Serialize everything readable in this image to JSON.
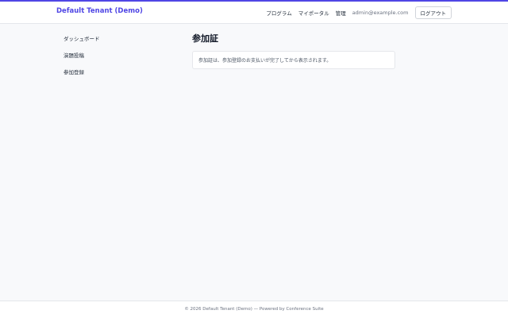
{
  "header": {
    "brand": "Default Tenant (Demo)",
    "nav": {
      "program": "プログラム",
      "my_portal": "マイポータル",
      "admin": "管理"
    },
    "user_email": "admin@example.com",
    "logout_label": "ログアウト",
    "accent_color": "#4f46e5"
  },
  "sidebar": {
    "items": [
      {
        "label": "ダッシュボード"
      },
      {
        "label": "演題投稿"
      },
      {
        "label": "参加登録"
      }
    ]
  },
  "main": {
    "title": "参加証",
    "notice": "参加証は、参加登録のお支払いが完了してから表示されます。"
  },
  "footer": {
    "text": "© 2026 Default Tenant (Demo) — Powered by Conference Suite"
  }
}
